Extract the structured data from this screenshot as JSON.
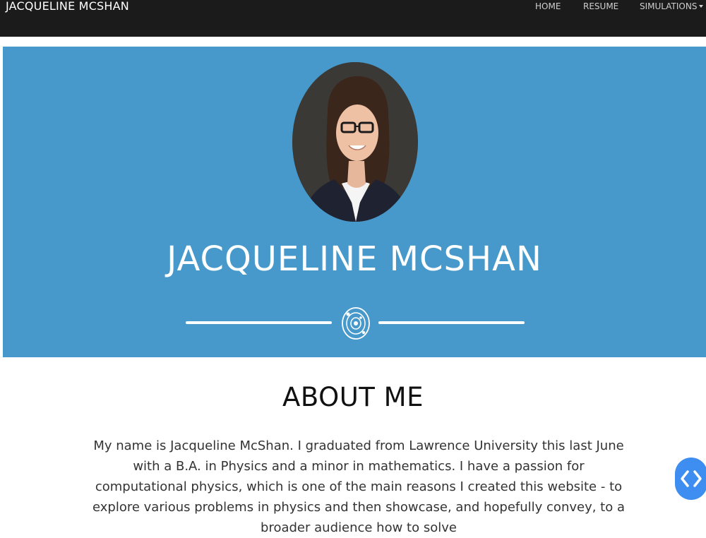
{
  "navbar": {
    "brand": "JACQUELINE MCSHAN",
    "links": [
      {
        "label": "HOME"
      },
      {
        "label": "RESUME"
      },
      {
        "label": "SIMULATIONS"
      }
    ]
  },
  "hero": {
    "title": "JACQUELINE MCSHAN",
    "divider_icon": "atom-orbit-icon",
    "avatar_icon": "profile-photo"
  },
  "about": {
    "title": "ABOUT ME",
    "text": "My name is Jacqueline McShan. I graduated from Lawrence University this last June with a B.A. in Physics and a minor in mathematics. I have a passion for computational physics, which is one of the main reasons I created this website - to explore various problems in physics and then showcase, and hopefully convey, to a broader audience how to solve"
  },
  "floating_button": {
    "icon": "code-brackets-icon"
  },
  "colors": {
    "navbar": "#1b1b1b",
    "hero": "#4699ca",
    "fab": "#3d8ef0"
  }
}
